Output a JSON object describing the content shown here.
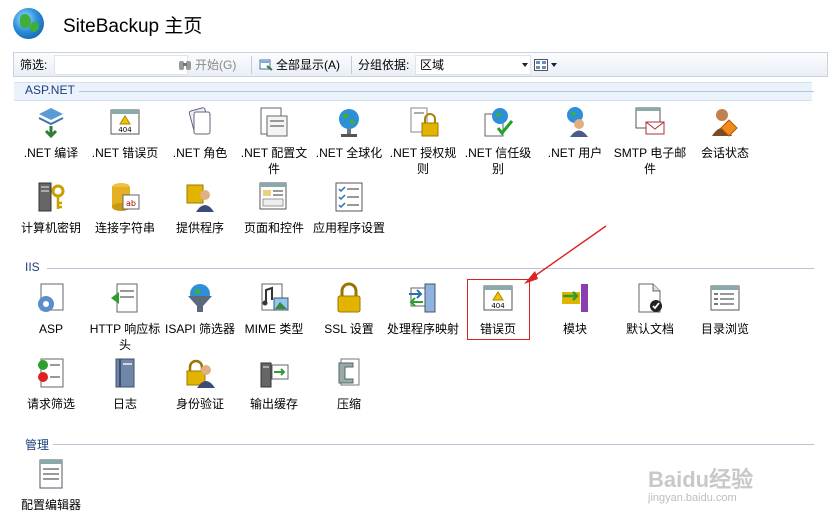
{
  "header": {
    "title": "SiteBackup 主页"
  },
  "toolbar": {
    "filter_label": "筛选:",
    "start_label": "开始(G)",
    "show_all_label": "全部显示(A)",
    "group_by_label": "分组依据:",
    "group_value": "区域"
  },
  "sections": {
    "aspnet": "ASP.NET",
    "iis": "IIS",
    "manage": "管理"
  },
  "aspnet_items": [
    ".NET 编译",
    ".NET 错误页",
    ".NET 角色",
    ".NET 配置文件",
    ".NET 全球化",
    ".NET 授权规则",
    ".NET 信任级别",
    ".NET 用户",
    "SMTP 电子邮件",
    "会话状态",
    "计算机密钥",
    "连接字符串",
    "提供程序",
    "页面和控件",
    "应用程序设置"
  ],
  "iis_items": [
    "ASP",
    "HTTP 响应标头",
    "ISAPI 筛选器",
    "MIME 类型",
    "SSL 设置",
    "处理程序映射",
    "错误页",
    "模块",
    "默认文档",
    "目录浏览",
    "请求筛选",
    "日志",
    "身份验证",
    "输出缓存",
    "压缩"
  ],
  "manage_items": [
    "配置编辑器"
  ],
  "watermark": {
    "main": "Baidu经验",
    "sub": "jingyan.baidu.com"
  },
  "colors": {
    "accent": "#1c3f7a",
    "highlight": "#dd2222"
  }
}
